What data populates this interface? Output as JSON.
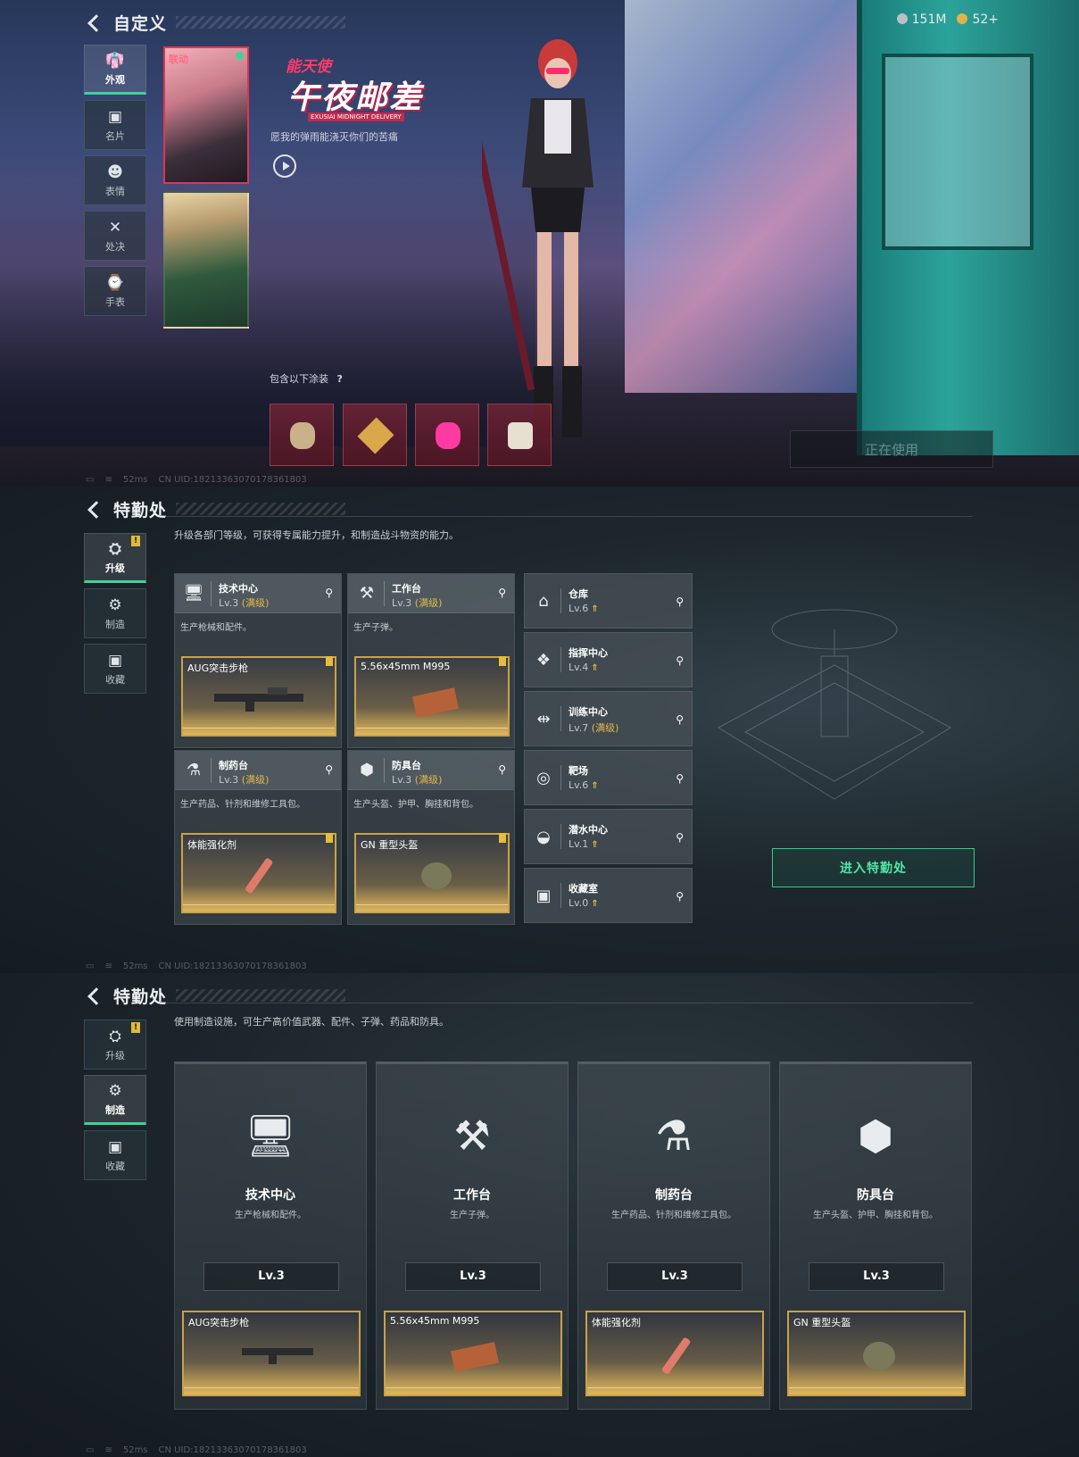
{
  "screen1": {
    "title": "自定义",
    "hud": {
      "coins": "151M",
      "tickets": "52+"
    },
    "nav": [
      {
        "label": "外观",
        "icon": "outfit-icon",
        "active": true
      },
      {
        "label": "名片",
        "icon": "card-icon",
        "active": false
      },
      {
        "label": "表情",
        "icon": "emote-icon",
        "active": false
      },
      {
        "label": "处决",
        "icon": "execution-icon",
        "active": false
      },
      {
        "label": "手表",
        "icon": "watch-icon",
        "active": false
      }
    ],
    "portrait1_tag": "联动",
    "skin": {
      "logo_top": "能天使",
      "logo_main": "午夜邮差",
      "logo_en": "EXUSIAI MIDNIGHT DELIVERY",
      "desc": "愿我的弹雨能浇灭你们的苦痛"
    },
    "includes_label": "包含以下涂装",
    "includes_help": "?",
    "in_use": "正在使用",
    "status": {
      "ping": "52ms",
      "uid": "CN UID:1821336307017836180​3"
    }
  },
  "screen2": {
    "title": "特勤处",
    "nav": [
      {
        "label": "升级",
        "icon": "upgrade-icon",
        "active": true,
        "badge": "!"
      },
      {
        "label": "制造",
        "icon": "craft-icon",
        "active": false
      },
      {
        "label": "收藏",
        "icon": "collection-icon",
        "active": false
      }
    ],
    "intro": "升级各部门等级，可获得专属能力提升，和制造战斗物资的能力。",
    "facilities": [
      {
        "name": "技术中心",
        "lv": "Lv.3",
        "max": "(满级)",
        "desc": "生产枪械和配件。",
        "product": "AUG突击步枪",
        "icon": "monitor-icon"
      },
      {
        "name": "工作台",
        "lv": "Lv.3",
        "max": "(满级)",
        "desc": "生产子弹。",
        "product": "5.56x45mm M995",
        "icon": "tools-icon"
      },
      {
        "name": "制药台",
        "lv": "Lv.3",
        "max": "(满级)",
        "desc": "生产药品、针剂和维修工具包。",
        "product": "体能强化剂",
        "icon": "microscope-icon"
      },
      {
        "name": "防具台",
        "lv": "Lv.3",
        "max": "(满级)",
        "desc": "生产头盔、护甲、胸挂和背包。",
        "product": "GN 重型头盔",
        "icon": "cubes-icon"
      }
    ],
    "others": [
      {
        "name": "仓库",
        "lv": "Lv.6",
        "max": "",
        "icon": "warehouse-icon",
        "upgradable": true
      },
      {
        "name": "指挥中心",
        "lv": "Lv.4",
        "max": "",
        "icon": "command-icon",
        "upgradable": true
      },
      {
        "name": "训练中心",
        "lv": "Lv.7",
        "max": "(满级)",
        "icon": "dumbbell-icon",
        "upgradable": false
      },
      {
        "name": "靶场",
        "lv": "Lv.6",
        "max": "",
        "icon": "target-icon",
        "upgradable": true
      },
      {
        "name": "潜水中心",
        "lv": "Lv.1",
        "max": "",
        "icon": "dive-icon",
        "upgradable": true
      },
      {
        "name": "收藏室",
        "lv": "Lv.0",
        "max": "",
        "icon": "vault-icon",
        "upgradable": true
      }
    ],
    "enter": "进入特勤处",
    "status": {
      "ping": "52ms",
      "uid": "CN UID:18213363070178361803"
    }
  },
  "screen3": {
    "title": "特勤处",
    "nav": [
      {
        "label": "升级",
        "icon": "upgrade-icon",
        "active": false,
        "badge": "!"
      },
      {
        "label": "制造",
        "icon": "craft-icon",
        "active": true
      },
      {
        "label": "收藏",
        "icon": "collection-icon",
        "active": false
      }
    ],
    "intro": "使用制造设施，可生产高价值武器、配件、子弹、药品和防具。",
    "cards": [
      {
        "name": "技术中心",
        "desc": "生产枪械和配件。",
        "lv": "Lv.3",
        "product": "AUG突击步枪"
      },
      {
        "name": "工作台",
        "desc": "生产子弹。",
        "lv": "Lv.3",
        "product": "5.56x45mm M995"
      },
      {
        "name": "制药台",
        "desc": "生产药品、针剂和维修工具包。",
        "lv": "Lv.3",
        "product": "体能强化剂"
      },
      {
        "name": "防具台",
        "desc": "生产头盔、护甲、胸挂和背包。",
        "lv": "Lv.3",
        "product": "GN 重型头盔"
      }
    ],
    "status": {
      "ping": "52ms",
      "uid": "CN UID:18213363070178361803"
    }
  }
}
